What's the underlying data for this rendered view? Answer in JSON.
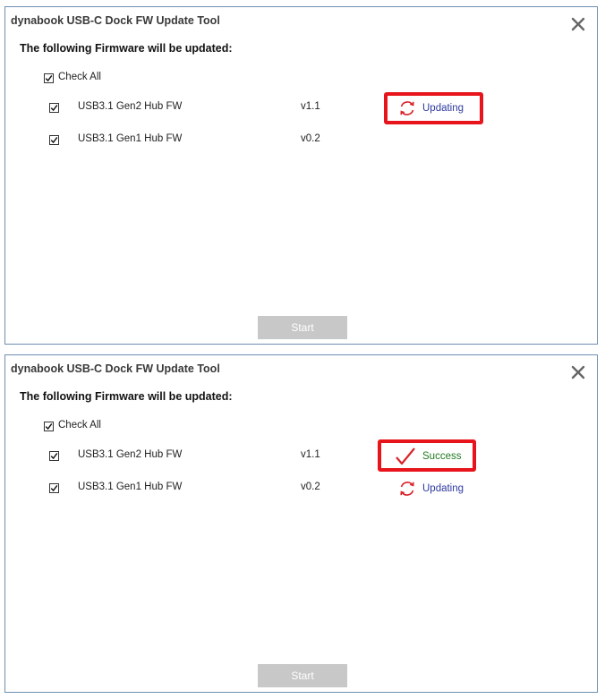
{
  "colors": {
    "border": "#6f8fb0",
    "highlight": "#e8141c",
    "updating_text": "#2e3aa0",
    "success_text": "#1f7a1f",
    "icon_red": "#d9222a",
    "button_disabled": "#c8c8c8"
  },
  "windows": [
    {
      "title": "dynabook USB-C Dock FW Update Tool",
      "close_icon": "close-icon",
      "heading": "The following Firmware will be updated:",
      "check_all": {
        "label": "Check All",
        "checked": true
      },
      "items": [
        {
          "name": "USB3.1 Gen2 Hub FW",
          "version": "v1.1",
          "checked": true,
          "status": "Updating",
          "status_icon": "refresh-icon",
          "highlighted": true
        },
        {
          "name": "USB3.1 Gen1 Hub FW",
          "version": "v0.2",
          "checked": true,
          "status": "",
          "status_icon": "",
          "highlighted": false
        }
      ],
      "start_button": {
        "label": "Start",
        "enabled": false
      }
    },
    {
      "title": "dynabook USB-C Dock FW Update Tool",
      "close_icon": "close-icon",
      "heading": "The following Firmware will be updated:",
      "check_all": {
        "label": "Check All",
        "checked": true
      },
      "items": [
        {
          "name": "USB3.1 Gen2 Hub FW",
          "version": "v1.1",
          "checked": true,
          "status": "Success",
          "status_icon": "checkmark-icon",
          "highlighted": true
        },
        {
          "name": "USB3.1 Gen1 Hub FW",
          "version": "v0.2",
          "checked": true,
          "status": "Updating",
          "status_icon": "refresh-icon",
          "highlighted": false
        }
      ],
      "start_button": {
        "label": "Start",
        "enabled": false
      }
    }
  ]
}
